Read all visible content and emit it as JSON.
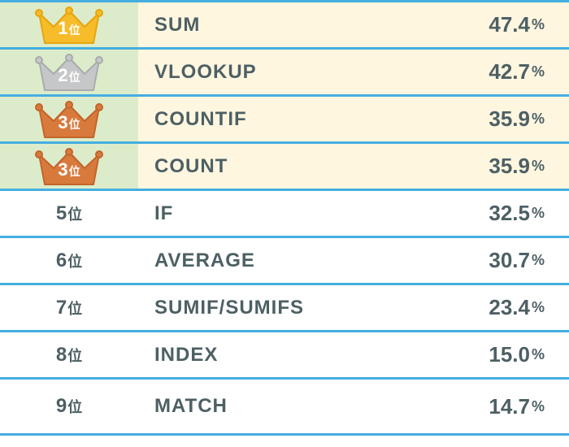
{
  "rank_suffix": "位",
  "percent_mark": "%",
  "crown_colors": {
    "gold": {
      "fill": "#f6bc2a",
      "stroke": "#e7a50b"
    },
    "silver": {
      "fill": "#c6c7c8",
      "stroke": "#a9abac"
    },
    "bronze": {
      "fill": "#d97a3d",
      "stroke": "#c3642a"
    }
  },
  "rows": [
    {
      "rank": "1",
      "name": "SUM",
      "pct": "47.4",
      "highlight": true,
      "crown": "gold"
    },
    {
      "rank": "2",
      "name": "VLOOKUP",
      "pct": "42.7",
      "highlight": true,
      "crown": "silver"
    },
    {
      "rank": "3",
      "name": "COUNTIF",
      "pct": "35.9",
      "highlight": true,
      "crown": "bronze"
    },
    {
      "rank": "3",
      "name": "COUNT",
      "pct": "35.9",
      "highlight": true,
      "crown": "bronze"
    },
    {
      "rank": "5",
      "name": "IF",
      "pct": "32.5",
      "highlight": false,
      "crown": null
    },
    {
      "rank": "6",
      "name": "AVERAGE",
      "pct": "30.7",
      "highlight": false,
      "crown": null
    },
    {
      "rank": "7",
      "name": "SUMIF/SUMIFS",
      "pct": "23.4",
      "highlight": false,
      "crown": null
    },
    {
      "rank": "8",
      "name": "INDEX",
      "pct": "15.0",
      "highlight": false,
      "crown": null
    },
    {
      "rank": "9",
      "name": "MATCH",
      "pct": "14.7",
      "highlight": false,
      "crown": null
    }
  ]
}
